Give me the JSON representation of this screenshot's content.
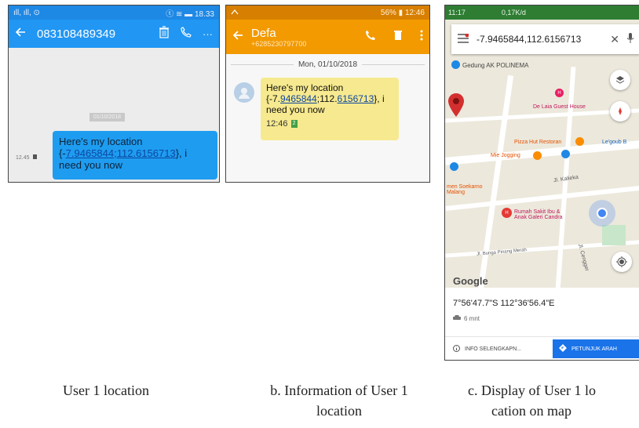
{
  "screenshot_a": {
    "status_left": "ıll, ıll, ⊙",
    "status_right": "ⓣ ≋ ▬ 18.33",
    "phone_number": "083108489349",
    "date_chip": "01/10/2018",
    "message_time": "12.45",
    "message_prefix": "Here's my location {-",
    "message_lat": "7.9465844",
    "message_sep": ";",
    "message_lng": "112.6156713",
    "message_suffix": "}, i need you now"
  },
  "screenshot_b": {
    "status_right": "56% ▮ 12:46",
    "contact_name": "Defa",
    "contact_number": "+6285230797700",
    "date_divider": "Mon, 01/10/2018",
    "message_prefix": "Here's my location {-7.",
    "message_lat_link": "9465844",
    "message_mid": ";112.",
    "message_lng_link": "6156713",
    "message_suffix": "}, i need you now",
    "message_time": "12:46"
  },
  "screenshot_c": {
    "status_left": "11:17",
    "status_mid": "0,17K/d",
    "search_query": "-7.9465844,112.6156713",
    "map_labels": {
      "gedung": "Gedung AK POLINEMA",
      "hotel": "De Laia Guest House",
      "pizza": "Pizza Hut Restoran",
      "jogging": "Mie Jogging",
      "legoub": "Le'goub B",
      "soekarno": "men Soekarno\nMalang",
      "kaliaki": "Jl. Kalieka",
      "rumah_sakit": "Rumah Sakit Ibu &\nAnak Galeri Candra",
      "bunga": "Jl. Bunga Pinang Merah",
      "cengger": "Jl. Cengger"
    },
    "google_logo": "Google",
    "coordinates_dms": "7°56'47.7\"S 112°36'56.4\"E",
    "eta": "6 mnt",
    "info_label": "INFO SELENGKAPN...",
    "directions_label": "PETUNJUK ARAH",
    "accent_blue": "#1a73e8",
    "pin_red": "#d32f2f"
  },
  "captions": {
    "a": "User 1 location",
    "b_line1": "b. Information of User 1",
    "b_line2": "location",
    "c_line1": "c. Display of User 1 lo",
    "c_line2": "cation on map"
  }
}
